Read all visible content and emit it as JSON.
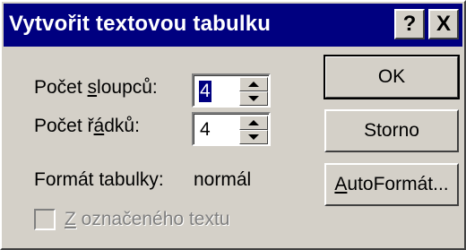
{
  "dialog": {
    "title": "Vytvořit textovou tabulku",
    "help_glyph": "?",
    "close_glyph": "X"
  },
  "columns": {
    "label_pre": "Počet ",
    "label_key": "s",
    "label_post": "loupců:",
    "value": "4"
  },
  "rows": {
    "label_pre": "Počet ř",
    "label_key": "á",
    "label_post": "dků:",
    "value": "4"
  },
  "format": {
    "label": "Formát tabulky:",
    "value": "normál"
  },
  "checkbox": {
    "label_key": "Z",
    "label_post": " označeného textu",
    "checked": false,
    "enabled": false
  },
  "buttons": {
    "ok": "OK",
    "cancel": "Storno",
    "autoformat_key": "A",
    "autoformat_post": "utoFormát..."
  },
  "icons": {
    "help": "help-icon",
    "close": "close-icon",
    "spin_up": "arrow-up-icon",
    "spin_down": "arrow-down-icon"
  }
}
